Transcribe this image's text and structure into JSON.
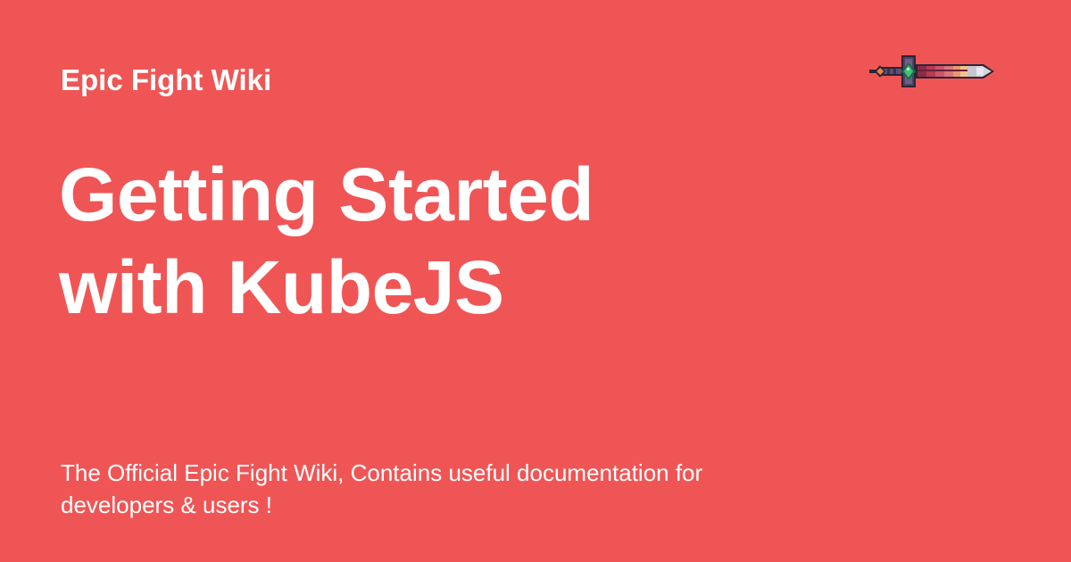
{
  "brand": {
    "site_name": "Epic Fight Wiki",
    "logo_icon": "sword-icon",
    "background_color": "#f05555",
    "text_color": "#ffffff"
  },
  "page": {
    "title_lines": [
      "Getting Started",
      "with KubeJS"
    ],
    "description": "The Official Epic Fight Wiki, Contains useful documentation for developers & users !"
  }
}
